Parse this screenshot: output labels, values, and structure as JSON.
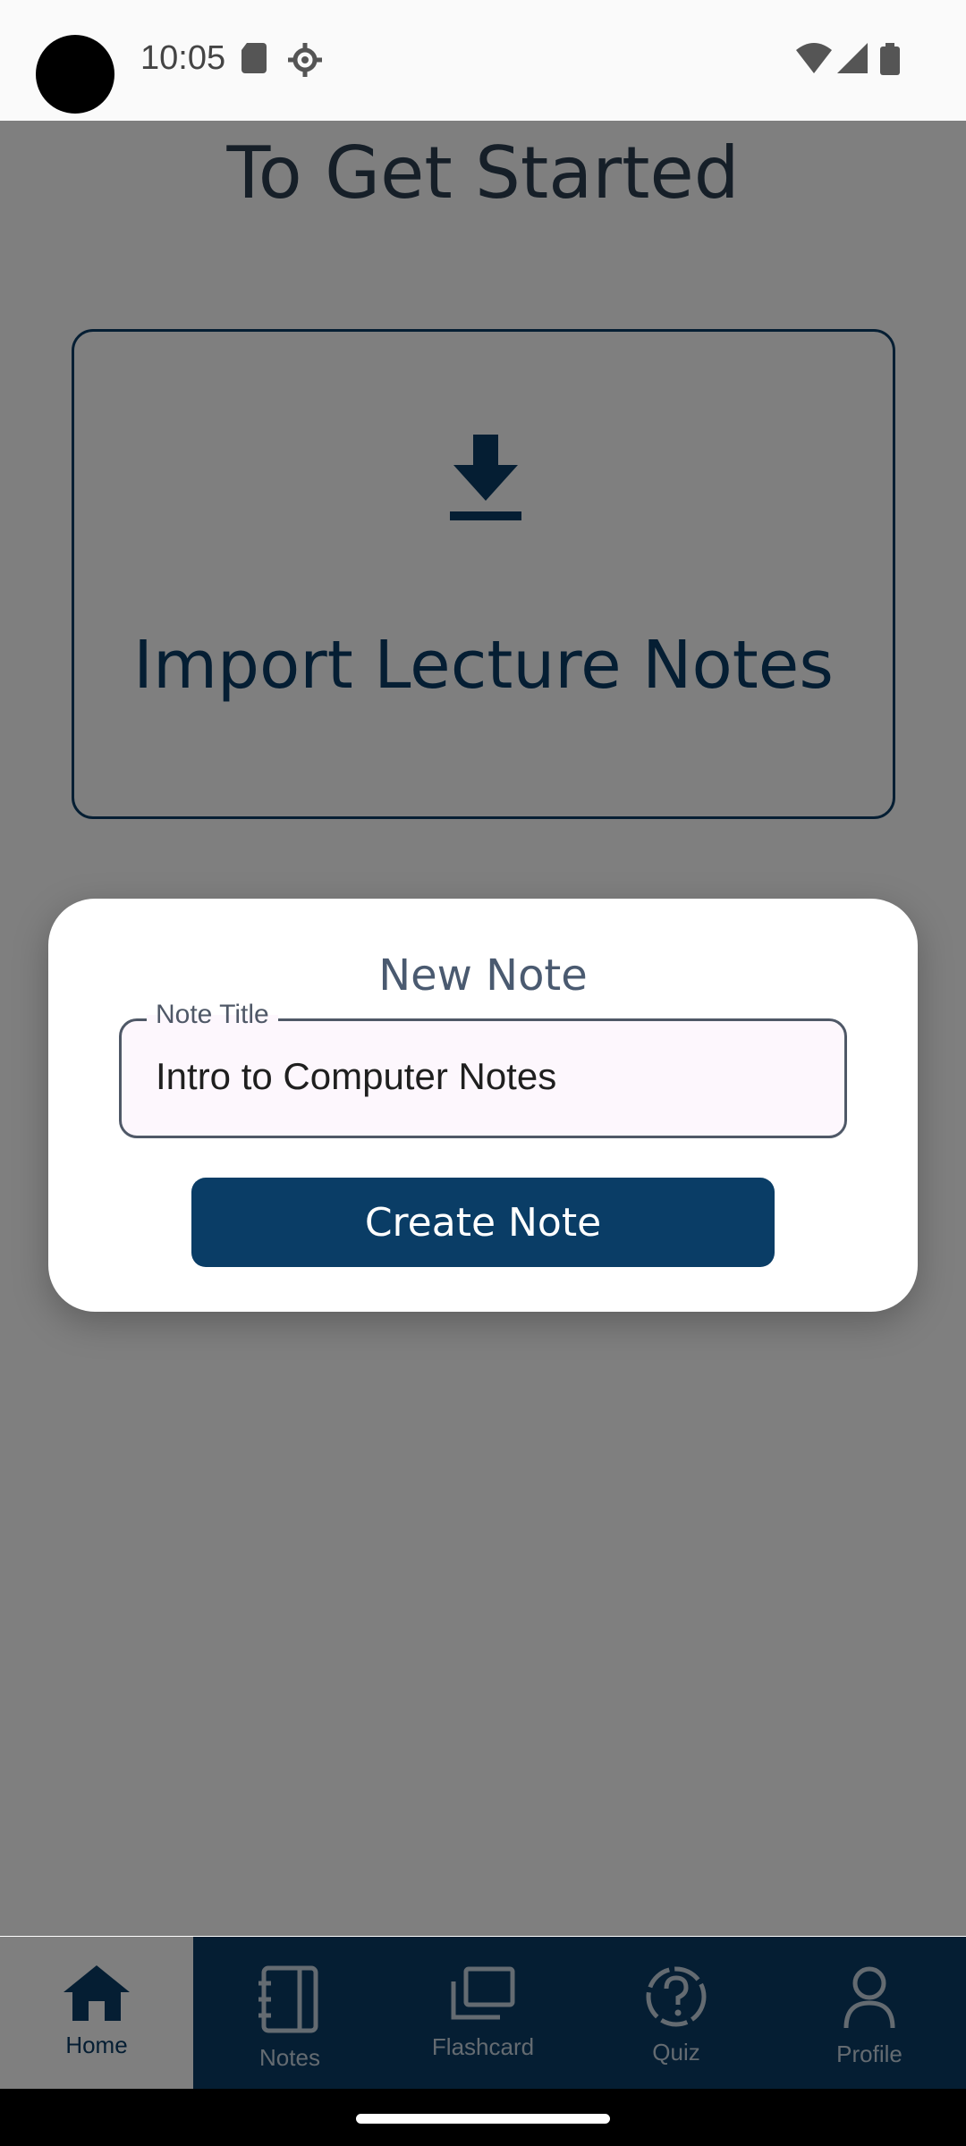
{
  "status_bar": {
    "time": "10:05"
  },
  "page": {
    "heading": "To Get Started",
    "import_card_label": "Import Lecture Notes"
  },
  "dialog": {
    "title": "New Note",
    "field_label": "Note Title",
    "field_value": "Intro to Computer Notes",
    "button_label": "Create Note"
  },
  "bottom_nav": {
    "items": [
      {
        "label": "Home",
        "icon": "home-icon"
      },
      {
        "label": "Notes",
        "icon": "notebook-icon"
      },
      {
        "label": "Flashcard",
        "icon": "flashcard-icon"
      },
      {
        "label": "Quiz",
        "icon": "quiz-icon"
      },
      {
        "label": "Profile",
        "icon": "profile-icon"
      }
    ],
    "active_index": 0
  },
  "colors": {
    "primary": "#0a3d66",
    "scrim": "rgba(0,0,0,0.5)",
    "dialog_bg": "#ffffff"
  }
}
